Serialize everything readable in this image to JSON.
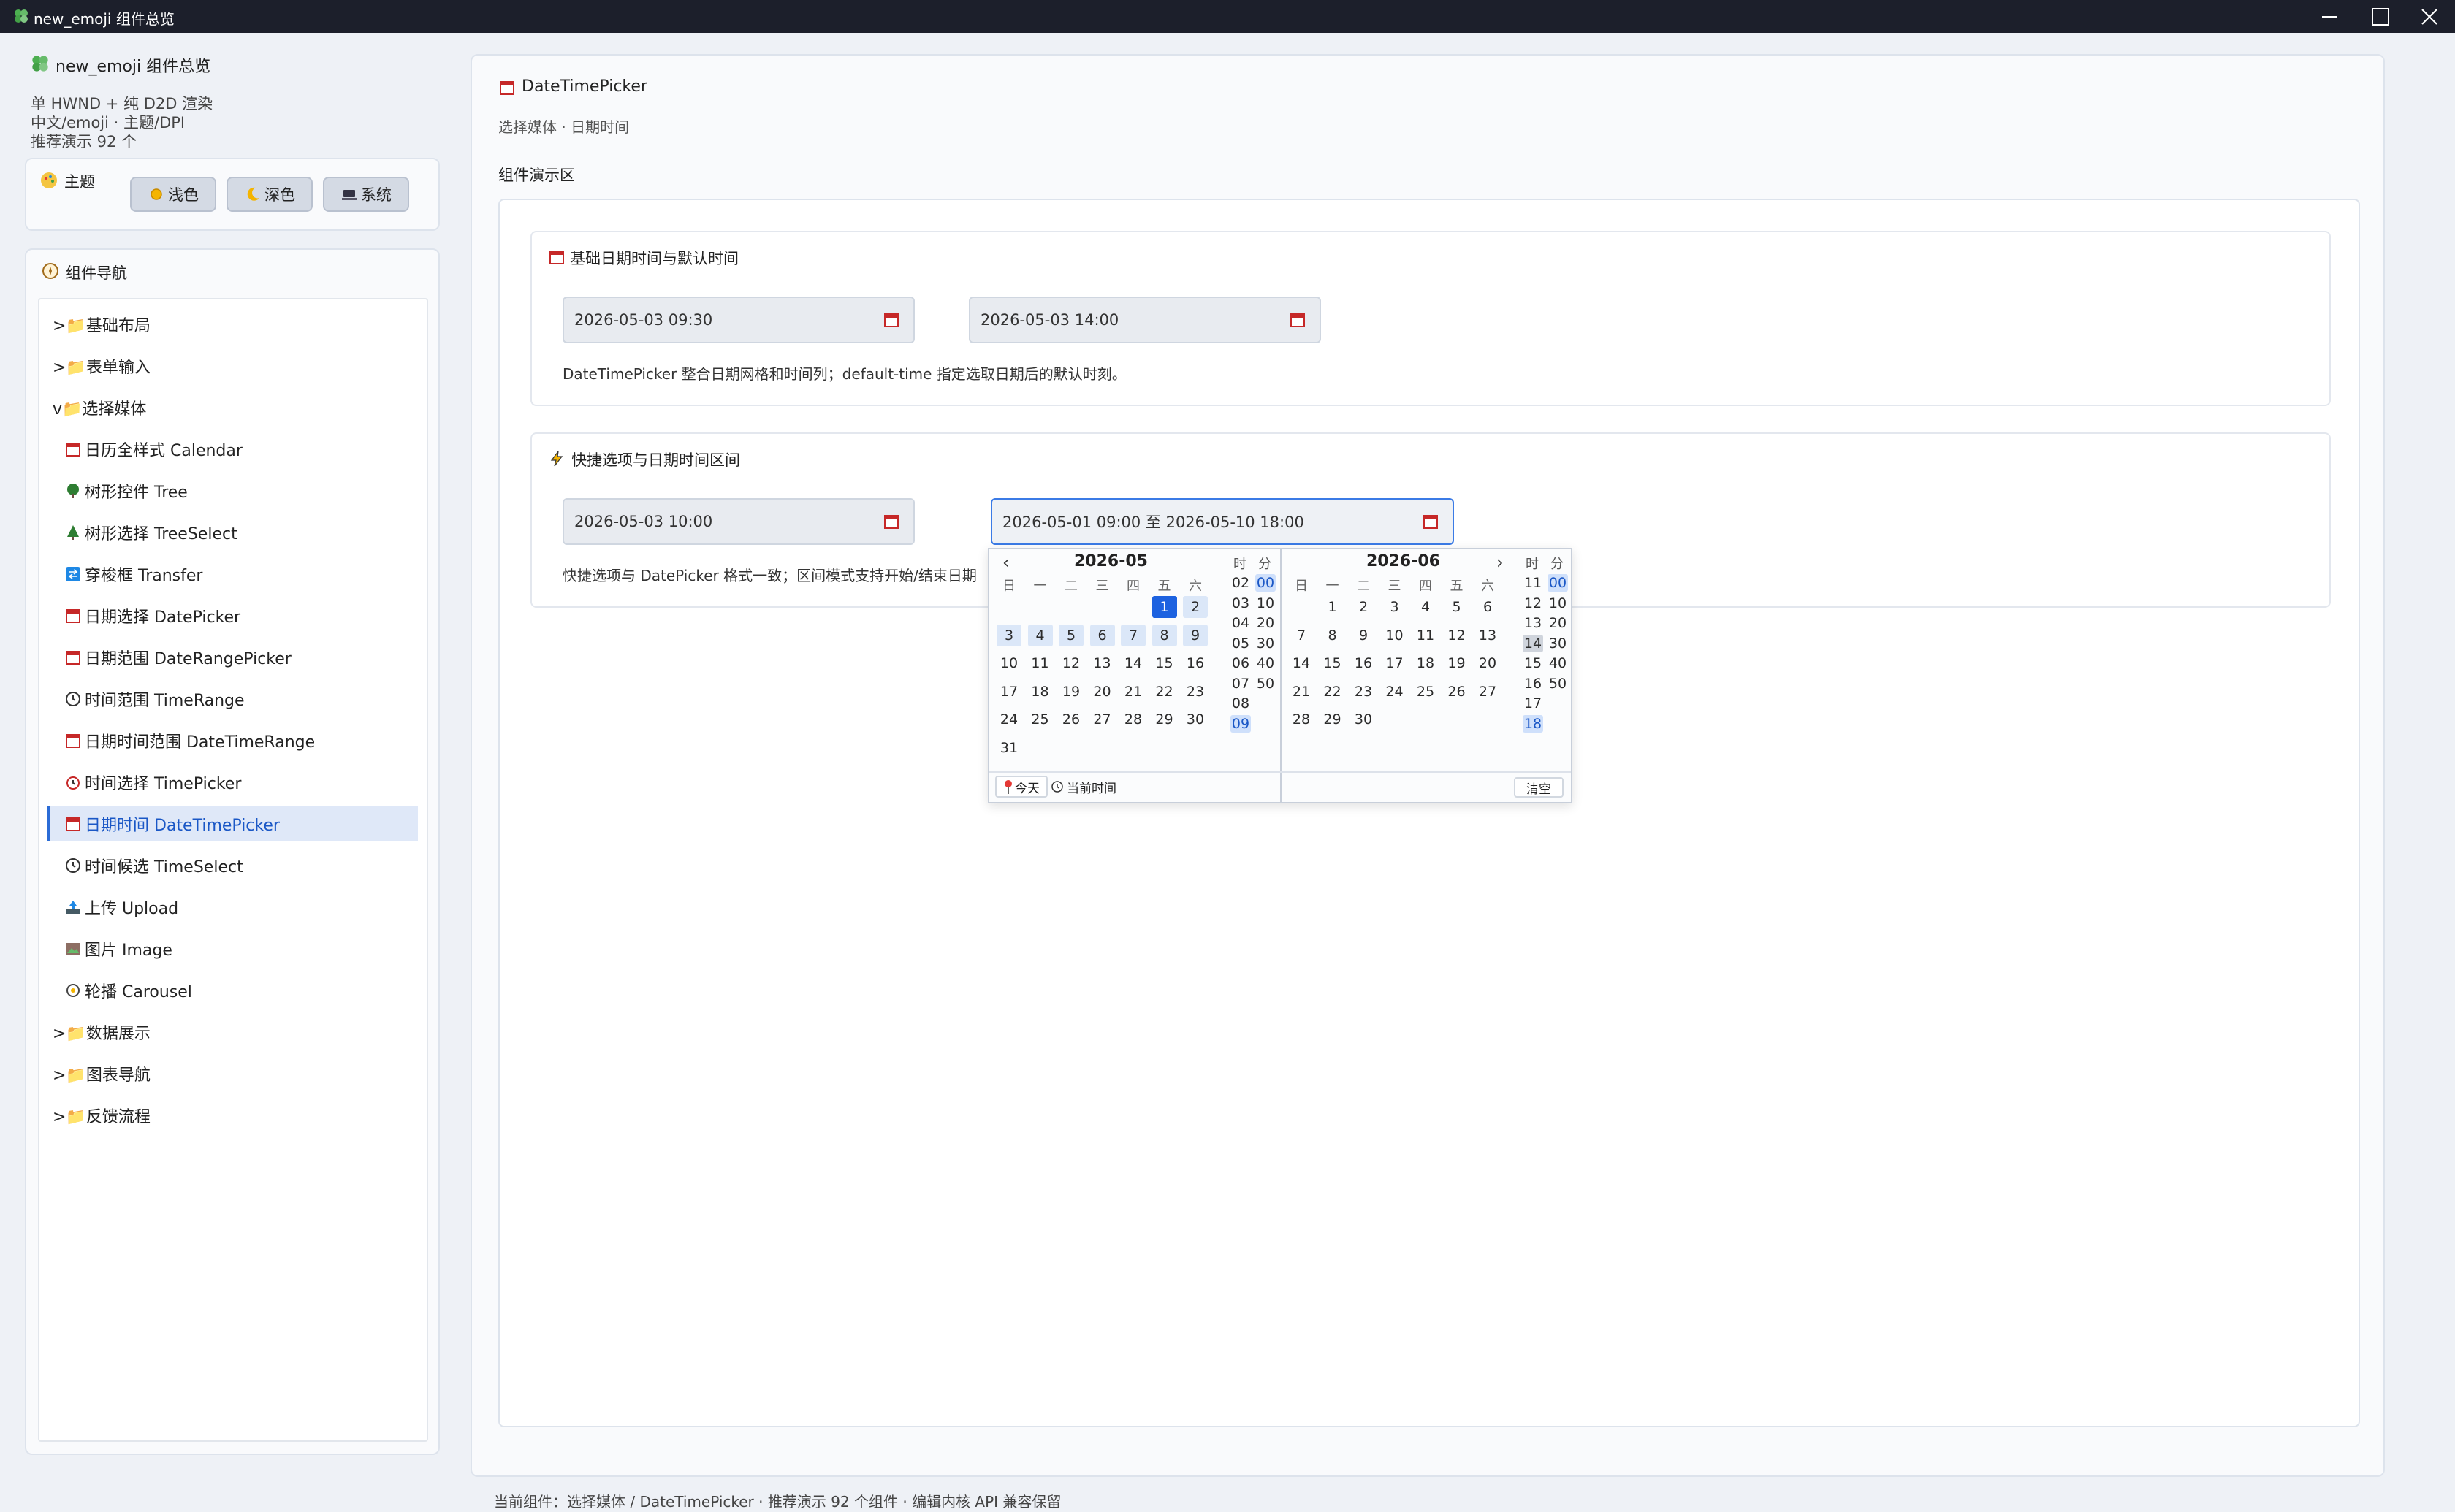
{
  "window": {
    "title": "new_emoji 组件总览"
  },
  "sidebar": {
    "app_title": "new_emoji 组件总览",
    "info_lines": [
      "单 HWND + 纯 D2D 渲染",
      "中文/emoji · 主题/DPI",
      "推荐演示 92 个"
    ],
    "theme": {
      "label": "主题",
      "buttons": [
        "浅色",
        "深色",
        "系统"
      ]
    },
    "nav": {
      "title": "组件导航",
      "items": [
        {
          "label": ">📁基础布局"
        },
        {
          "label": ">📁表单输入"
        },
        {
          "label": "v📁选择媒体"
        },
        {
          "label": "日历全样式 Calendar"
        },
        {
          "label": "树形控件 Tree"
        },
        {
          "label": "树形选择 TreeSelect"
        },
        {
          "label": "穿梭框 Transfer"
        },
        {
          "label": "日期选择 DatePicker"
        },
        {
          "label": "日期范围 DateRangePicker"
        },
        {
          "label": "时间范围 TimeRange"
        },
        {
          "label": "日期时间范围 DateTimeRange"
        },
        {
          "label": "时间选择 TimePicker"
        },
        {
          "label": "日期时间 DateTimePicker"
        },
        {
          "label": "时间候选 TimeSelect"
        },
        {
          "label": "上传 Upload"
        },
        {
          "label": "图片 Image"
        },
        {
          "label": "轮播 Carousel"
        },
        {
          "label": ">📁数据展示"
        },
        {
          "label": ">📁图表导航"
        },
        {
          "label": ">📁反馈流程"
        }
      ]
    }
  },
  "main": {
    "title": "DateTimePicker",
    "subtitle": "选择媒体 · 日期时间",
    "demo_label": "组件演示区",
    "section1": {
      "title": "基础日期时间与默认时间",
      "input1": "2026-05-03 09:30",
      "input2": "2026-05-03 14:00",
      "desc": "DateTimePicker 整合日期网格和时间列；default-time 指定选取日期后的默认时刻。"
    },
    "section2": {
      "title": "快捷选项与日期时间区间",
      "input1": "2026-05-03 10:00",
      "input2": "2026-05-01 09:00 至 2026-05-10 18:00",
      "desc": "快捷选项与 DatePicker 格式一致；区间模式支持开始/结束日期"
    },
    "status": "当前组件：选择媒体 / DateTimePicker · 推荐演示 92 个组件 · 编辑内核 API 兼容保留"
  },
  "popup": {
    "left": {
      "prev": "‹",
      "title": "2026-05",
      "weekdays": [
        "日",
        "一",
        "二",
        "三",
        "四",
        "五",
        "六"
      ],
      "days": [
        "",
        "",
        "",
        "",
        "",
        "1",
        "2",
        "3",
        "4",
        "5",
        "6",
        "7",
        "8",
        "9",
        "10",
        "11",
        "12",
        "13",
        "14",
        "15",
        "16",
        "17",
        "18",
        "19",
        "20",
        "21",
        "22",
        "23",
        "24",
        "25",
        "26",
        "27",
        "28",
        "29",
        "30",
        "31"
      ],
      "time_head": [
        "时",
        "分"
      ],
      "hours": [
        "02",
        "03",
        "04",
        "05",
        "06",
        "07",
        "08",
        "09"
      ],
      "minutes": [
        "00",
        "10",
        "20",
        "30",
        "40",
        "50"
      ]
    },
    "right": {
      "next": "›",
      "title": "2026-06",
      "weekdays": [
        "日",
        "一",
        "二",
        "三",
        "四",
        "五",
        "六"
      ],
      "days": [
        "",
        "1",
        "2",
        "3",
        "4",
        "5",
        "6",
        "7",
        "8",
        "9",
        "10",
        "11",
        "12",
        "13",
        "14",
        "15",
        "16",
        "17",
        "18",
        "19",
        "20",
        "21",
        "22",
        "23",
        "24",
        "25",
        "26",
        "27",
        "28",
        "29",
        "30"
      ],
      "time_head": [
        "时",
        "分"
      ],
      "hours": [
        "11",
        "12",
        "13",
        "14",
        "15",
        "16",
        "17",
        "18"
      ],
      "minutes": [
        "00",
        "10",
        "20",
        "30",
        "40",
        "50"
      ]
    },
    "footer": {
      "today": "今天",
      "now": "当前时间",
      "clear": "清空"
    }
  }
}
